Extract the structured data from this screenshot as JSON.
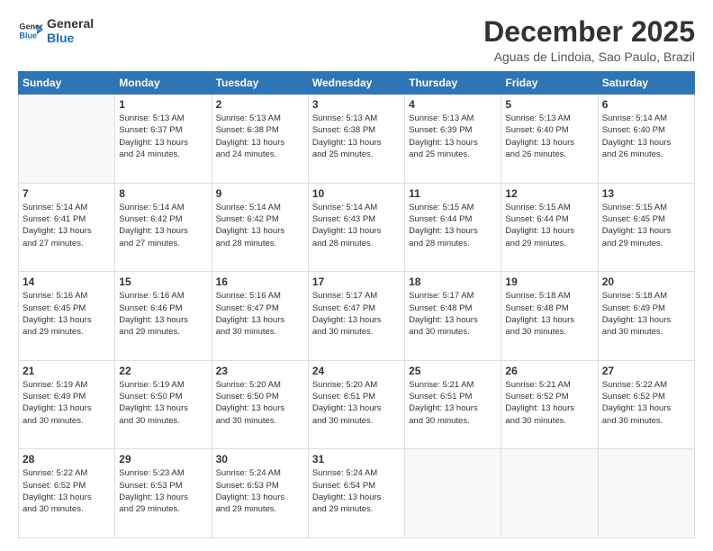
{
  "logo": {
    "line1": "General",
    "line2": "Blue"
  },
  "title": "December 2025",
  "subtitle": "Aguas de Lindoia, Sao Paulo, Brazil",
  "days_header": [
    "Sunday",
    "Monday",
    "Tuesday",
    "Wednesday",
    "Thursday",
    "Friday",
    "Saturday"
  ],
  "weeks": [
    [
      {
        "day": "",
        "content": ""
      },
      {
        "day": "1",
        "content": "Sunrise: 5:13 AM\nSunset: 6:37 PM\nDaylight: 13 hours\nand 24 minutes."
      },
      {
        "day": "2",
        "content": "Sunrise: 5:13 AM\nSunset: 6:38 PM\nDaylight: 13 hours\nand 24 minutes."
      },
      {
        "day": "3",
        "content": "Sunrise: 5:13 AM\nSunset: 6:38 PM\nDaylight: 13 hours\nand 25 minutes."
      },
      {
        "day": "4",
        "content": "Sunrise: 5:13 AM\nSunset: 6:39 PM\nDaylight: 13 hours\nand 25 minutes."
      },
      {
        "day": "5",
        "content": "Sunrise: 5:13 AM\nSunset: 6:40 PM\nDaylight: 13 hours\nand 26 minutes."
      },
      {
        "day": "6",
        "content": "Sunrise: 5:14 AM\nSunset: 6:40 PM\nDaylight: 13 hours\nand 26 minutes."
      }
    ],
    [
      {
        "day": "7",
        "content": "Sunrise: 5:14 AM\nSunset: 6:41 PM\nDaylight: 13 hours\nand 27 minutes."
      },
      {
        "day": "8",
        "content": "Sunrise: 5:14 AM\nSunset: 6:42 PM\nDaylight: 13 hours\nand 27 minutes."
      },
      {
        "day": "9",
        "content": "Sunrise: 5:14 AM\nSunset: 6:42 PM\nDaylight: 13 hours\nand 28 minutes."
      },
      {
        "day": "10",
        "content": "Sunrise: 5:14 AM\nSunset: 6:43 PM\nDaylight: 13 hours\nand 28 minutes."
      },
      {
        "day": "11",
        "content": "Sunrise: 5:15 AM\nSunset: 6:44 PM\nDaylight: 13 hours\nand 28 minutes."
      },
      {
        "day": "12",
        "content": "Sunrise: 5:15 AM\nSunset: 6:44 PM\nDaylight: 13 hours\nand 29 minutes."
      },
      {
        "day": "13",
        "content": "Sunrise: 5:15 AM\nSunset: 6:45 PM\nDaylight: 13 hours\nand 29 minutes."
      }
    ],
    [
      {
        "day": "14",
        "content": "Sunrise: 5:16 AM\nSunset: 6:45 PM\nDaylight: 13 hours\nand 29 minutes."
      },
      {
        "day": "15",
        "content": "Sunrise: 5:16 AM\nSunset: 6:46 PM\nDaylight: 13 hours\nand 29 minutes."
      },
      {
        "day": "16",
        "content": "Sunrise: 5:16 AM\nSunset: 6:47 PM\nDaylight: 13 hours\nand 30 minutes."
      },
      {
        "day": "17",
        "content": "Sunrise: 5:17 AM\nSunset: 6:47 PM\nDaylight: 13 hours\nand 30 minutes."
      },
      {
        "day": "18",
        "content": "Sunrise: 5:17 AM\nSunset: 6:48 PM\nDaylight: 13 hours\nand 30 minutes."
      },
      {
        "day": "19",
        "content": "Sunrise: 5:18 AM\nSunset: 6:48 PM\nDaylight: 13 hours\nand 30 minutes."
      },
      {
        "day": "20",
        "content": "Sunrise: 5:18 AM\nSunset: 6:49 PM\nDaylight: 13 hours\nand 30 minutes."
      }
    ],
    [
      {
        "day": "21",
        "content": "Sunrise: 5:19 AM\nSunset: 6:49 PM\nDaylight: 13 hours\nand 30 minutes."
      },
      {
        "day": "22",
        "content": "Sunrise: 5:19 AM\nSunset: 6:50 PM\nDaylight: 13 hours\nand 30 minutes."
      },
      {
        "day": "23",
        "content": "Sunrise: 5:20 AM\nSunset: 6:50 PM\nDaylight: 13 hours\nand 30 minutes."
      },
      {
        "day": "24",
        "content": "Sunrise: 5:20 AM\nSunset: 6:51 PM\nDaylight: 13 hours\nand 30 minutes."
      },
      {
        "day": "25",
        "content": "Sunrise: 5:21 AM\nSunset: 6:51 PM\nDaylight: 13 hours\nand 30 minutes."
      },
      {
        "day": "26",
        "content": "Sunrise: 5:21 AM\nSunset: 6:52 PM\nDaylight: 13 hours\nand 30 minutes."
      },
      {
        "day": "27",
        "content": "Sunrise: 5:22 AM\nSunset: 6:52 PM\nDaylight: 13 hours\nand 30 minutes."
      }
    ],
    [
      {
        "day": "28",
        "content": "Sunrise: 5:22 AM\nSunset: 6:52 PM\nDaylight: 13 hours\nand 30 minutes."
      },
      {
        "day": "29",
        "content": "Sunrise: 5:23 AM\nSunset: 6:53 PM\nDaylight: 13 hours\nand 29 minutes."
      },
      {
        "day": "30",
        "content": "Sunrise: 5:24 AM\nSunset: 6:53 PM\nDaylight: 13 hours\nand 29 minutes."
      },
      {
        "day": "31",
        "content": "Sunrise: 5:24 AM\nSunset: 6:54 PM\nDaylight: 13 hours\nand 29 minutes."
      },
      {
        "day": "",
        "content": ""
      },
      {
        "day": "",
        "content": ""
      },
      {
        "day": "",
        "content": ""
      }
    ]
  ]
}
